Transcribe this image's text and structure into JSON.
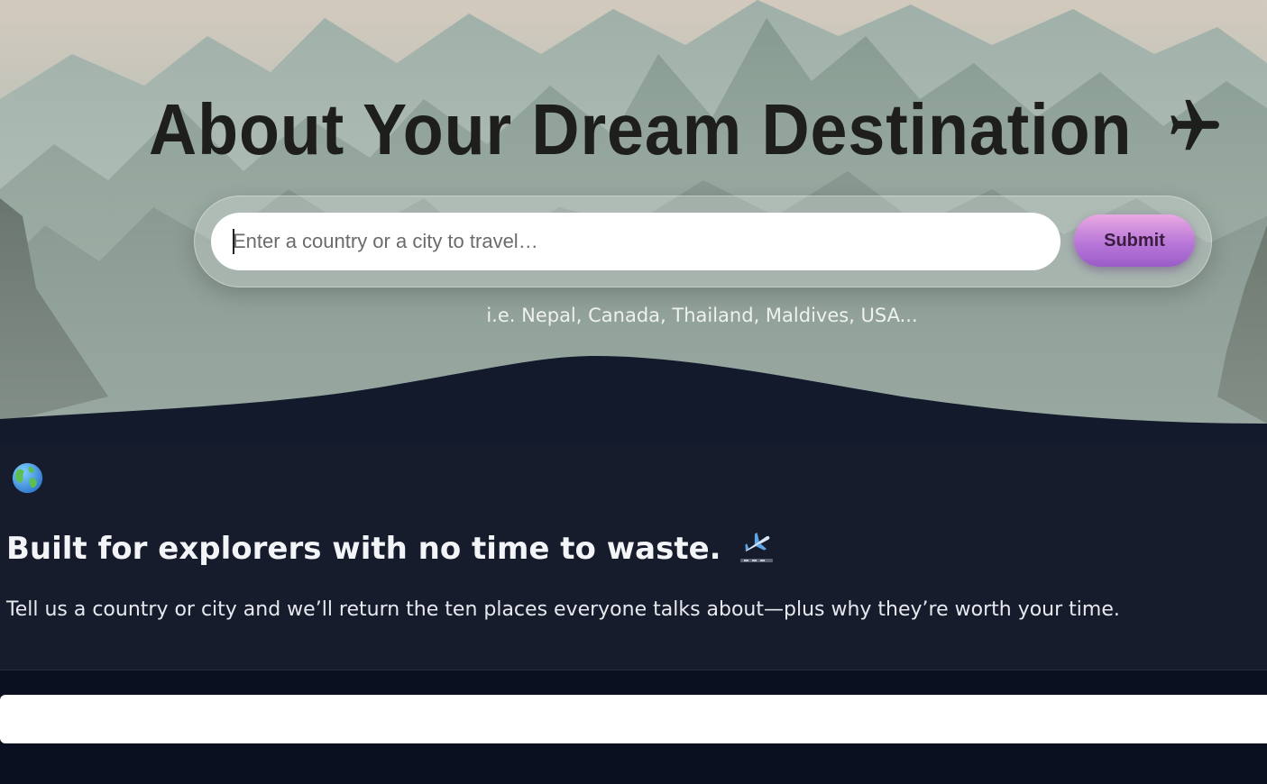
{
  "hero": {
    "title": "About Your Dream Destination",
    "title_icon": "airplane-icon",
    "search": {
      "placeholder": "Enter a country or a city to travel…",
      "value": ""
    },
    "submit_label": "Submit",
    "hint": "i.e. Nepal, Canada, Thailand, Maldives, USA..."
  },
  "info": {
    "icon": "globe-icon",
    "heading": "Built for explorers with no time to waste.",
    "heading_icon": "airplane-departure-icon",
    "description": "Tell us a country or city and we’ll return the ten places everyone talks about—plus why they’re worth your time."
  },
  "colors": {
    "hero_title": "#1e1f1d",
    "submit_gradient_top": "#e9a9e2",
    "submit_gradient_bottom": "#9a5cc8",
    "info_bg": "#161c2c",
    "page_bg": "#0b1020"
  }
}
